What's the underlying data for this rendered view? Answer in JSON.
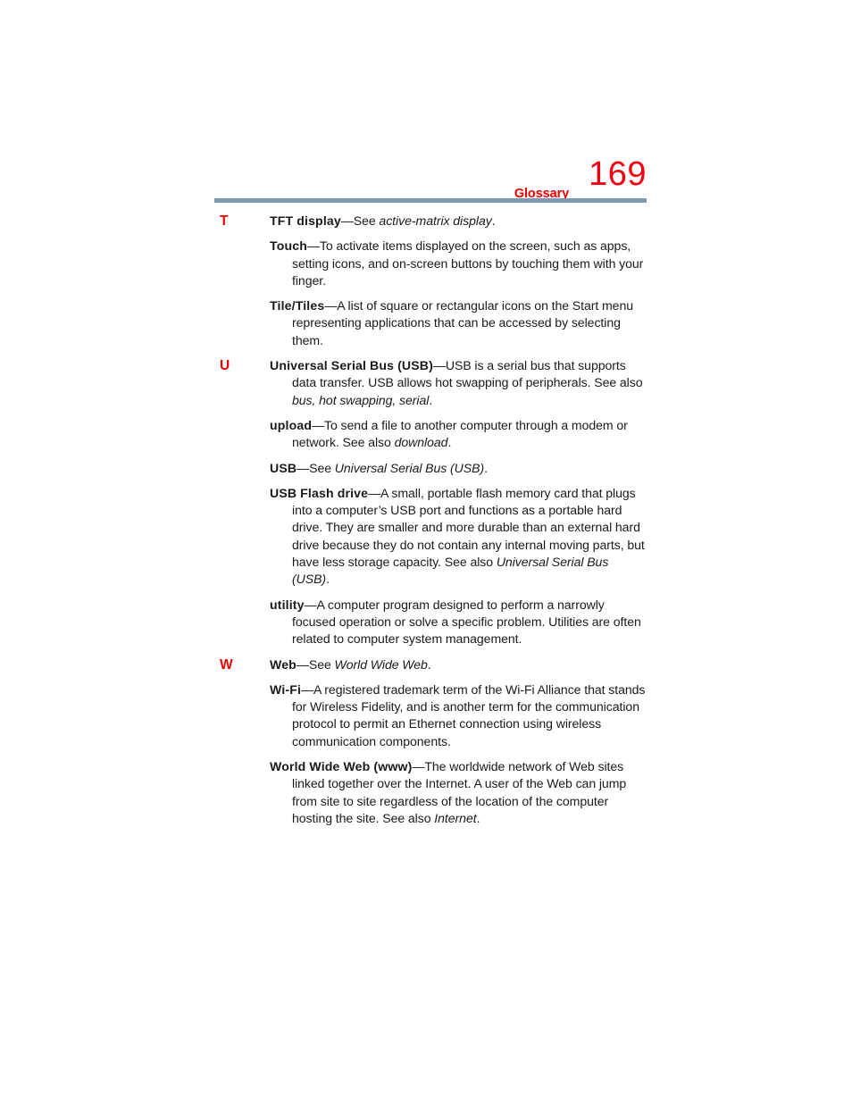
{
  "header": {
    "section_title": "Glossary",
    "page_number": "169",
    "title_color": "#ee0000",
    "rule_color": "#7f99b0"
  },
  "glossary": {
    "entries": [
      {
        "letter": "T",
        "term": "TFT display",
        "dash": "—",
        "definition_before": "See ",
        "italic": "active-matrix display",
        "definition_after": "."
      },
      {
        "letter": "",
        "term": "Touch",
        "dash": "—",
        "definition_before": "To activate items displayed on the screen, such as apps, setting icons, and on-screen buttons by touching them with your finger.",
        "italic": "",
        "definition_after": ""
      },
      {
        "letter": "",
        "term": "Tile/Tiles",
        "dash": "—",
        "definition_before": "A list of square or rectangular icons on the Start menu representing applications that can be accessed by selecting them.",
        "italic": "",
        "definition_after": ""
      },
      {
        "letter": "U",
        "term": "Universal Serial Bus (USB)",
        "dash": "—",
        "definition_before": "USB is a serial bus that supports data transfer. USB allows hot swapping of peripherals. See also ",
        "italic": "bus, hot swapping, serial",
        "definition_after": "."
      },
      {
        "letter": "",
        "term": "upload",
        "dash": "—",
        "definition_before": "To send a file to another computer through a modem or network. See also ",
        "italic": "download",
        "definition_after": "."
      },
      {
        "letter": "",
        "term": "USB",
        "dash": "—",
        "definition_before": "See ",
        "italic": "Universal Serial Bus (USB)",
        "definition_after": "."
      },
      {
        "letter": "",
        "term": "USB Flash drive",
        "dash": "—",
        "definition_before": "A small, portable flash memory card that plugs into a computer’s USB port and functions as a portable hard drive. They are smaller and more durable than an external hard drive because they do not contain any internal moving parts, but have less storage capacity. See also ",
        "italic": "Universal Serial Bus (USB)",
        "definition_after": "."
      },
      {
        "letter": "",
        "term": "utility",
        "dash": "—",
        "definition_before": "A computer program designed to perform a narrowly focused operation or solve a specific problem. Utilities are often related to computer system management.",
        "italic": "",
        "definition_after": ""
      },
      {
        "letter": "W",
        "term": "Web",
        "dash": "—",
        "definition_before": "See ",
        "italic": "World Wide Web",
        "definition_after": "."
      },
      {
        "letter": "",
        "term": "Wi-Fi",
        "dash": "—",
        "definition_before": "A registered trademark term of the Wi-Fi Alliance that stands for Wireless Fidelity, and is another term for the communication protocol to permit an Ethernet connection using wireless communication components.",
        "italic": "",
        "definition_after": ""
      },
      {
        "letter": "",
        "term": "World Wide Web (www)",
        "dash": "—",
        "definition_before": "The worldwide network of Web sites linked together over the Internet. A user of the Web can jump from site to site regardless of the location of the computer hosting the site. See also ",
        "italic": "Internet",
        "definition_after": "."
      }
    ]
  }
}
